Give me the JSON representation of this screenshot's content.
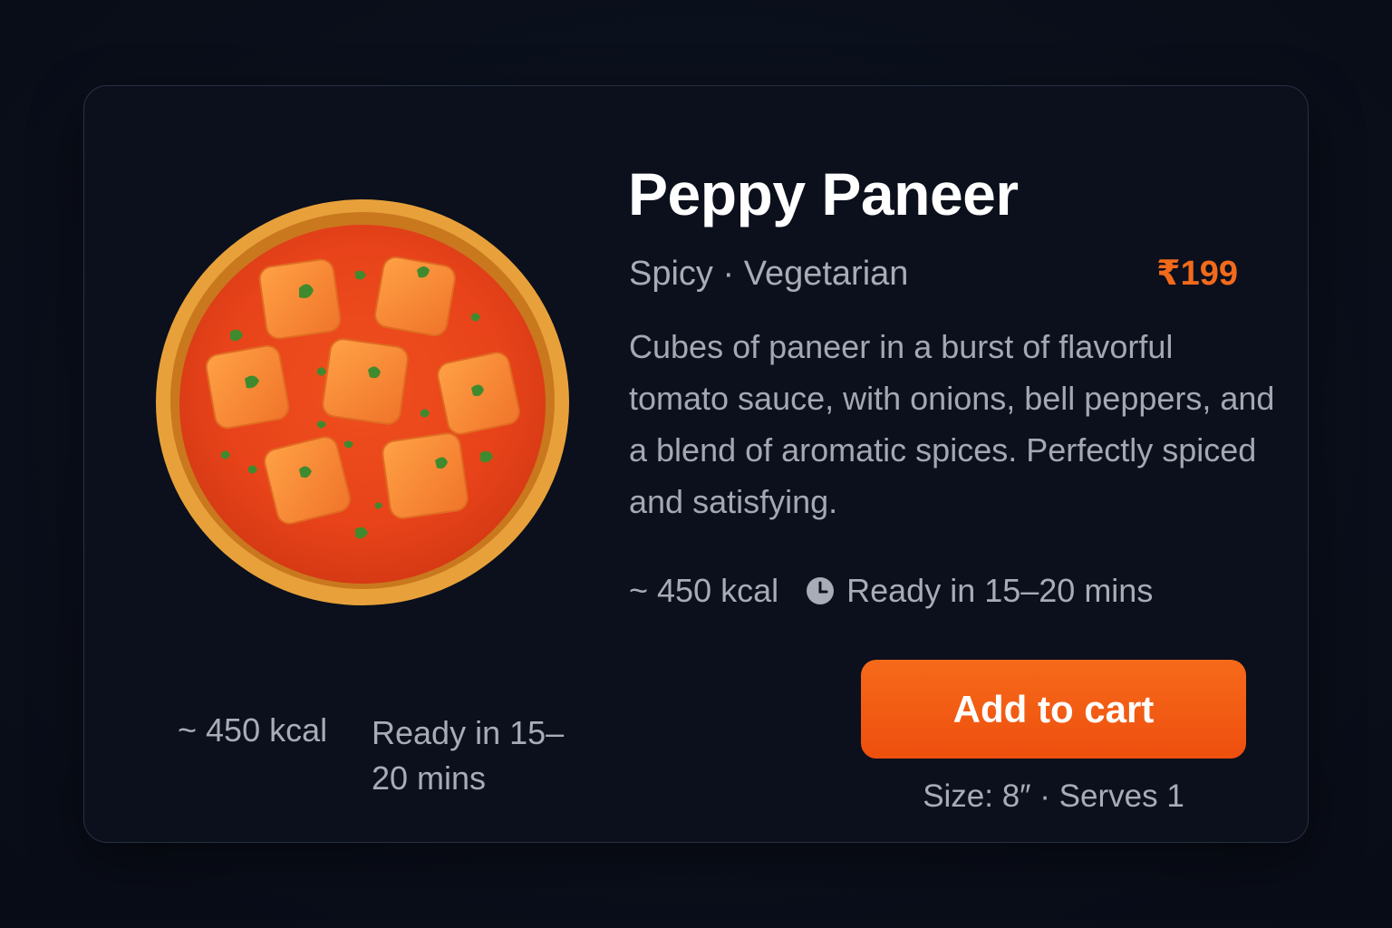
{
  "product": {
    "name": "Peppy Paneer",
    "tags": "Spicy · Vegetarian",
    "price": "₹199",
    "description": "Cubes of paneer in a burst of flavorful tomato sauce, with onions, bell peppers, and a blend of aromatic spices. Perfectly spiced and satisfying.",
    "calories": "~ 450 kcal",
    "ready_time": "Ready in 15–20 mins",
    "image_icon": "paneer-curry-bowl"
  },
  "summary": {
    "calories": "~ 450 kcal",
    "ready_time": "Ready in 15–20 mins"
  },
  "actions": {
    "add_to_cart_label": "Add to cart",
    "size_info": "Size: 8″ · Serves 1"
  },
  "colors": {
    "accent": "#f26a1b",
    "button": "#f35d14",
    "background": "#0a0f1b",
    "card": "#0b101c",
    "muted_text": "#a7acb6"
  }
}
